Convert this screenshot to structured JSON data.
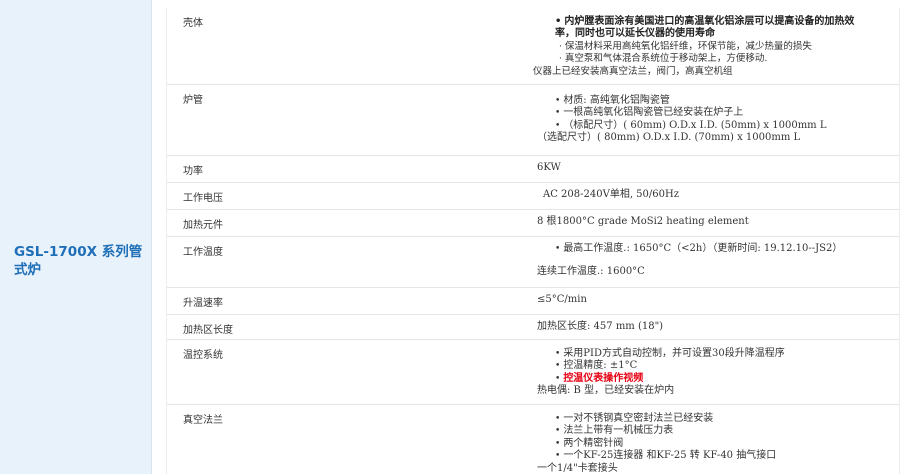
{
  "sidebar": {
    "title": "GSL-1700X 系列管式炉",
    "accent": "#1e6fb8",
    "background": "#e8f2fb"
  },
  "rows": {
    "shell": {
      "label": "壳体",
      "l1": "内炉膛表面涂有美国进口的高温氧化铝涂层可以提高设备的加热效",
      "l2": "率，同时也可以延长仪器的使用寿命",
      "l3": "保温材料采用高纯氧化铝纤维，环保节能，减少热量的损失",
      "l4": "真空泵和气体混合系统位于移动架上，方便移动.",
      "l5": "仪器上已经安装高真空法兰，阀门，高真空机组"
    },
    "tube": {
      "label": "炉管",
      "l1": "材质: 高纯氧化铝陶瓷管",
      "l2": "一根高纯氧化铝陶瓷管已经安装在炉子上",
      "l3": "（标配尺寸）( 60mm) O.D.x I.D. (50mm) x 1000mm L",
      "l4": "（选配尺寸）( 80mm) O.D.x I.D. (70mm) x  1000mm L"
    },
    "power": {
      "label": "功率",
      "value": "6KW"
    },
    "voltage": {
      "label": "工作电压",
      "value": "AC 208-240V单相, 50/60Hz"
    },
    "element": {
      "label": "加热元件",
      "value": "8 根1800°C grade MoSi2 heating element"
    },
    "temperature": {
      "label": "工作温度",
      "l1": "最高工作温度.: 1650°C（<2h）（更新时间: 19.12.10--JS2）",
      "l2": "连续工作温度.: 1600°C"
    },
    "rate": {
      "label": "升温速率",
      "value": "≤5°C/min"
    },
    "zone": {
      "label": "加热区长度",
      "value": "加热区长度: 457 mm (18\")"
    },
    "control": {
      "label": "温控系统",
      "l1": "采用PID方式自动控制，并可设置30段升降温程序",
      "l2": "控温精度: ±1°C",
      "l3": "控温仪表操作视频",
      "l4": "热电偶: B 型，已经安装在炉内"
    },
    "flange": {
      "label": "真空法兰",
      "l1": "一对不锈钢真空密封法兰已经安装",
      "l2": "法兰上带有一机械压力表",
      "l3": "两个精密针阀",
      "l4": "一个KF-25连接器 和KF-25 转 KF-40 抽气接口",
      "l5": "一个1/4\"卡套接头"
    }
  },
  "colors": {
    "link_red": "#e60012",
    "text": "#333333",
    "divider": "#e6e6e6"
  }
}
